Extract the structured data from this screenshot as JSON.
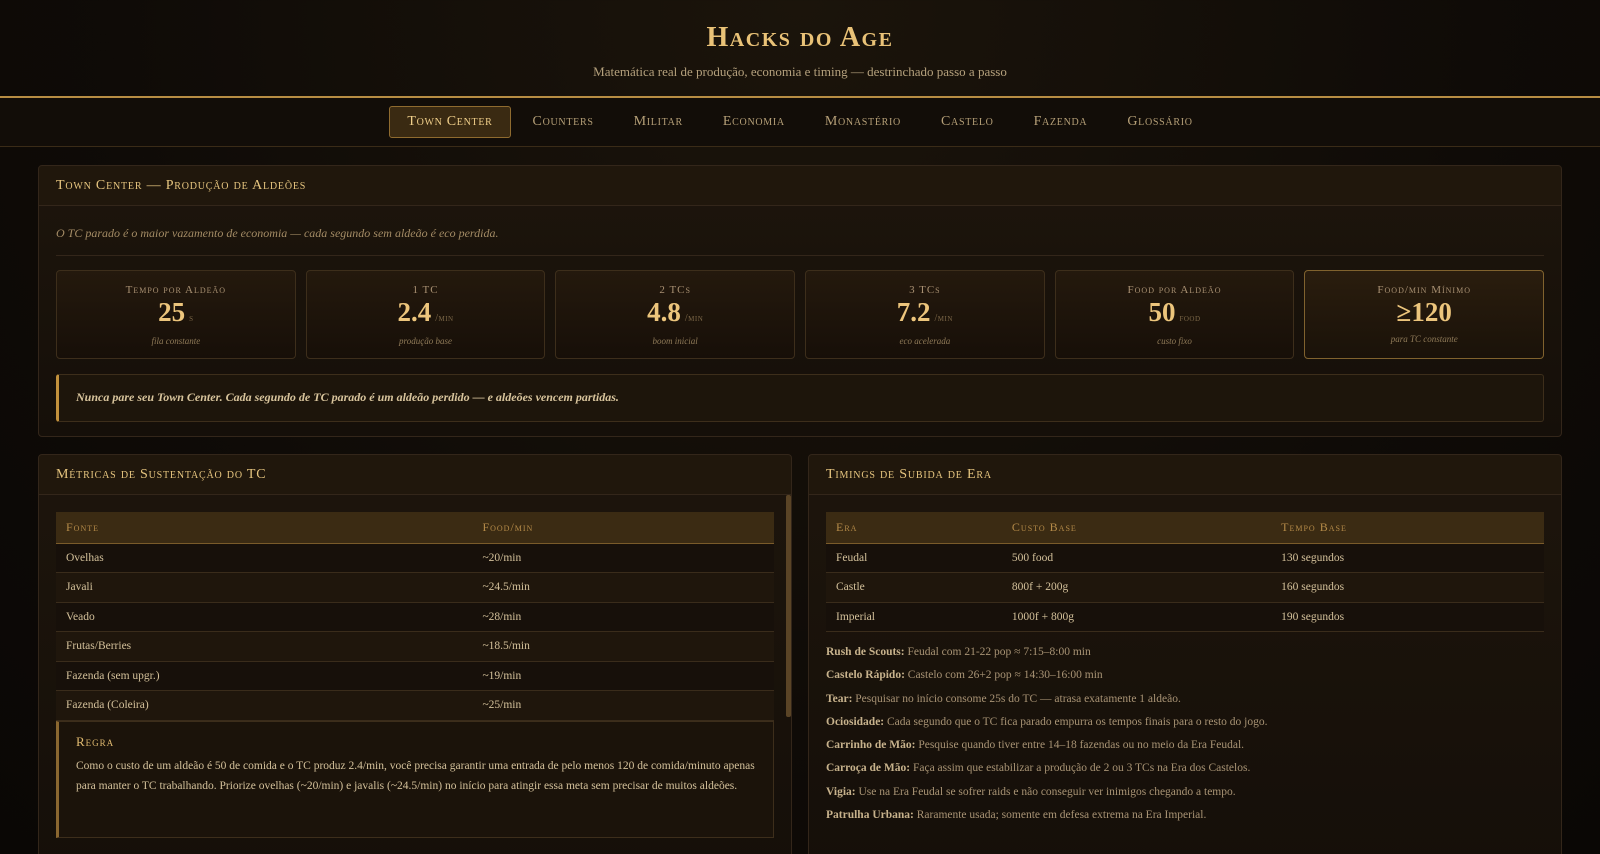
{
  "header": {
    "title": "Hacks do Age",
    "subtitle": "Matemática real de produção, economia e timing — destrinchado passo a passo"
  },
  "nav": {
    "tabs": [
      {
        "label": "Town Center",
        "active": true
      },
      {
        "label": "Counters"
      },
      {
        "label": "Militar"
      },
      {
        "label": "Economia"
      },
      {
        "label": "Monastério"
      },
      {
        "label": "Castelo"
      },
      {
        "label": "Fazenda"
      },
      {
        "label": "Glossário"
      }
    ]
  },
  "tc": {
    "title": "Town Center — Produção de Aldeões",
    "intro": "O TC parado é o maior vazamento de economia — cada segundo sem aldeão é eco perdida.",
    "stats": [
      {
        "label": "Tempo por Aldeão",
        "value": "25",
        "unit": "s",
        "note": "fila constante"
      },
      {
        "label": "1 TC",
        "value": "2.4",
        "unit": "/min",
        "note": "produção base"
      },
      {
        "label": "2 TCs",
        "value": "4.8",
        "unit": "/min",
        "note": "boom inicial"
      },
      {
        "label": "3 TCs",
        "value": "7.2",
        "unit": "/min",
        "note": "eco acelerada"
      },
      {
        "label": "Food por Aldeão",
        "value": "50",
        "unit": "food",
        "note": "custo fixo"
      },
      {
        "label": "Food/min Mínimo",
        "value": "≥120",
        "unit": "",
        "note": "para TC constante"
      }
    ],
    "callout": "Nunca pare seu Town Center. Cada segundo de TC parado é um aldeão perdido — e aldeões vencem partidas."
  },
  "metrics": {
    "title": "Métricas de Sustentação do TC",
    "columns": [
      "Fonte",
      "Food/min"
    ],
    "rows": [
      [
        "Ovelhas",
        "~20/min"
      ],
      [
        "Javali",
        "~24.5/min"
      ],
      [
        "Veado",
        "~28/min"
      ],
      [
        "Frutas/Berries",
        "~18.5/min"
      ],
      [
        "Fazenda (sem upgr.)",
        "~19/min"
      ],
      [
        "Fazenda (Coleira)",
        "~25/min"
      ]
    ],
    "rule": {
      "title": "Regra",
      "text": "Como o custo de um aldeão é 50 de comida e o TC produz 2.4/min, você precisa garantir uma entrada de pelo menos 120 de comida/minuto apenas para manter o TC trabalhando. Priorize ovelhas (~20/min) e javalis (~24.5/min) no início para atingir essa meta sem precisar de muitos aldeões."
    }
  },
  "timings": {
    "title": "Timings de Subida de Era",
    "columns": [
      "Era",
      "Custo Base",
      "Tempo Base"
    ],
    "rows": [
      [
        "Feudal",
        "500 food",
        "130 segundos"
      ],
      [
        "Castle",
        "800f + 200g",
        "160 segundos"
      ],
      [
        "Imperial",
        "1000f + 800g",
        "190 segundos"
      ]
    ],
    "notes": [
      {
        "label": "Rush de Scouts:",
        "text": "Feudal com 21-22 pop ≈ 7:15–8:00 min"
      },
      {
        "label": "Castelo Rápido:",
        "text": "Castelo com 26+2 pop ≈ 14:30–16:00 min"
      },
      {
        "label": "Tear:",
        "text": "Pesquisar no início consome 25s do TC — atrasa exatamente 1 aldeão."
      },
      {
        "label": "Ociosidade:",
        "text": "Cada segundo que o TC fica parado empurra os tempos finais para o resto do jogo."
      },
      {
        "label": "Carrinho de Mão:",
        "text": "Pesquise quando tiver entre 14–18 fazendas ou no meio da Era Feudal."
      },
      {
        "label": "Carroça de Mão:",
        "text": "Faça assim que estabilizar a produção de 2 ou 3 TCs na Era dos Castelos."
      },
      {
        "label": "Vigia:",
        "text": "Use na Era Feudal se sofrer raids e não conseguir ver inimigos chegando a tempo."
      },
      {
        "label": "Patrulha Urbana:",
        "text": "Raramente usada; somente em defesa extrema na Era Imperial."
      }
    ]
  }
}
